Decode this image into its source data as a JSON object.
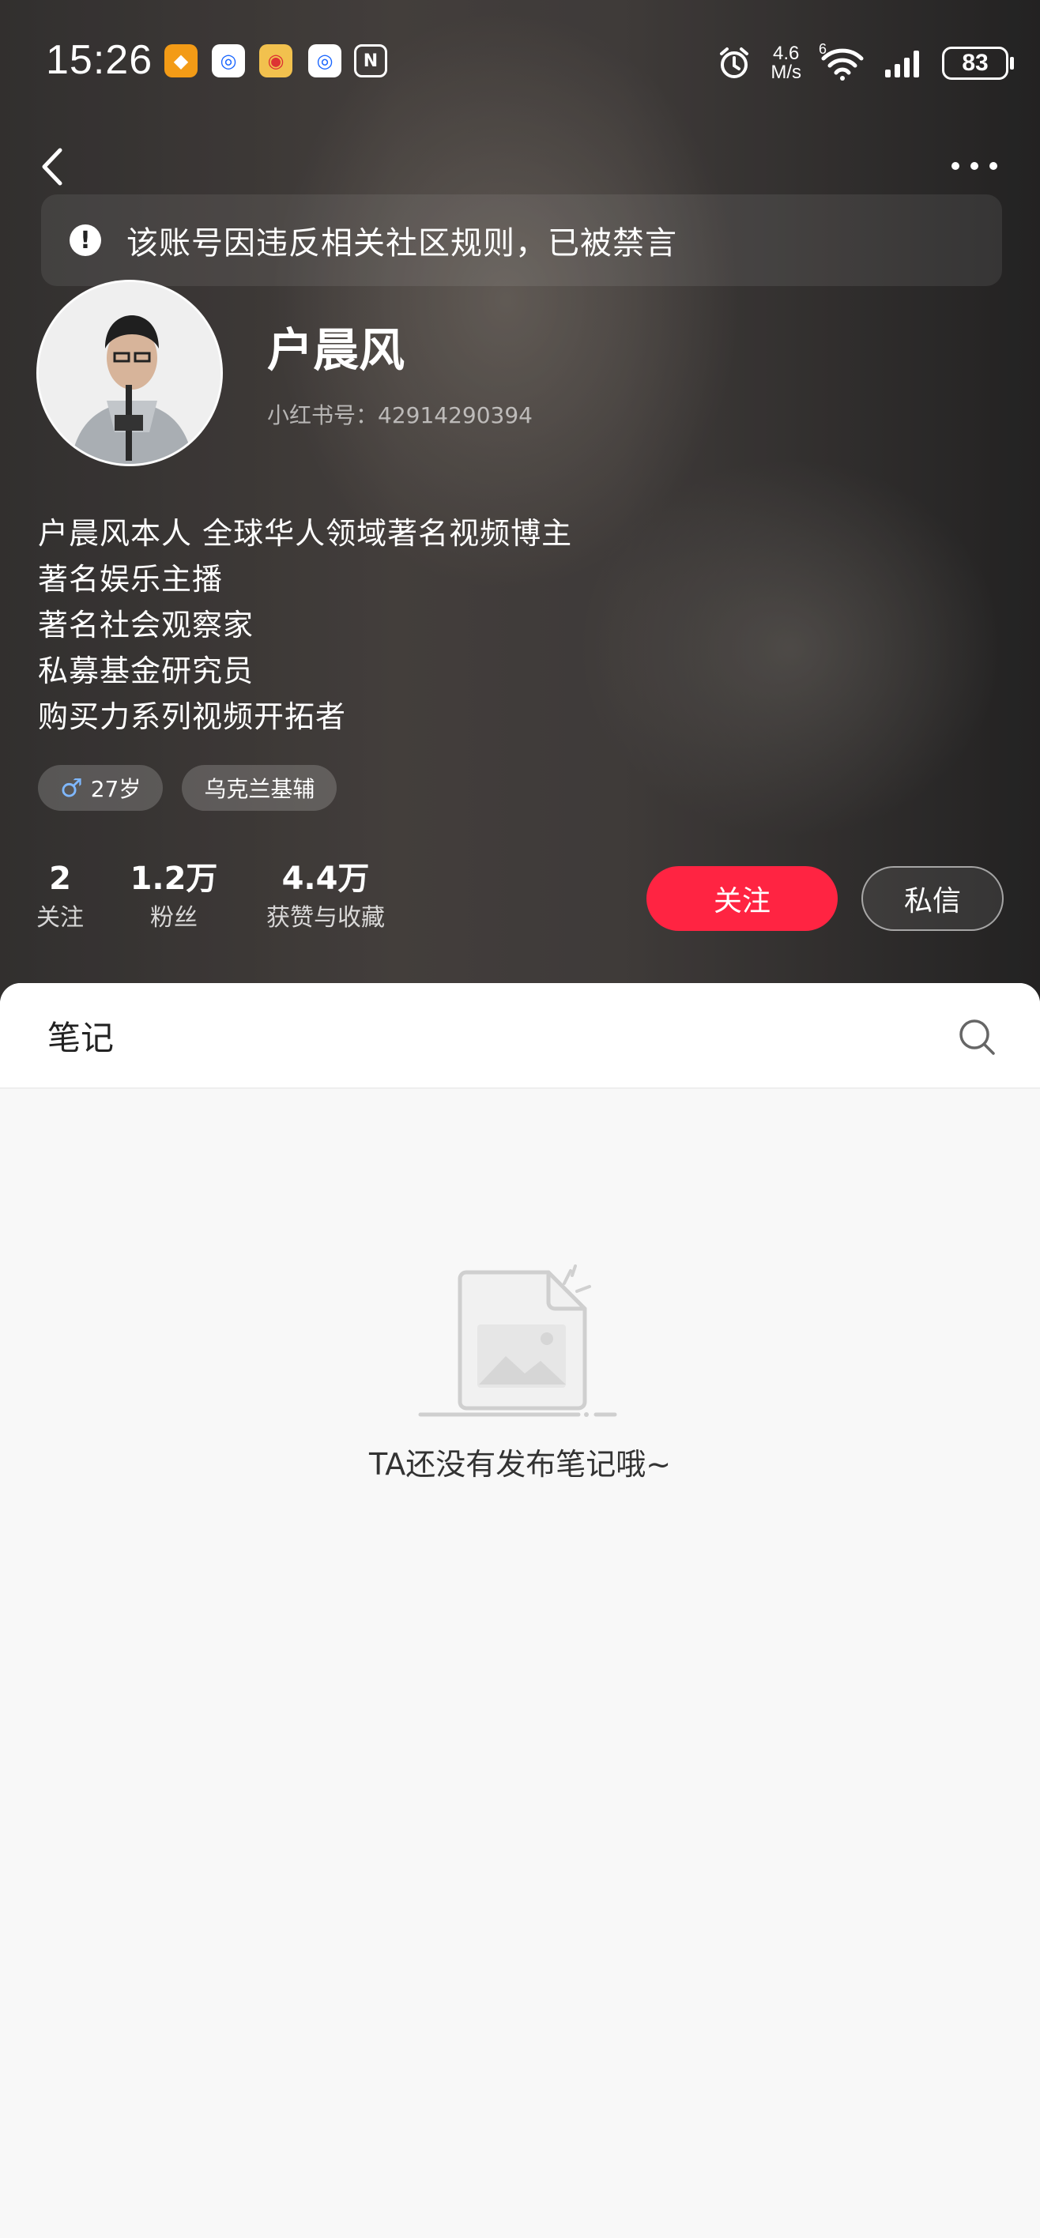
{
  "status_bar": {
    "time": "15:26",
    "apps": [
      {
        "icon": "taobao-icon",
        "glyph": "◆",
        "color": "#f39b16"
      },
      {
        "icon": "app-icon",
        "glyph": "◎",
        "color": "#1a66ff"
      },
      {
        "icon": "weibo-icon",
        "glyph": "◉",
        "color": "#e8a23a"
      },
      {
        "icon": "app-icon",
        "glyph": "◎",
        "color": "#1a66ff"
      },
      {
        "icon": "nfc-icon",
        "glyph": "N",
        "color": "transparent"
      }
    ],
    "speed_value": "4.6",
    "speed_unit": "M/s",
    "network": "6",
    "battery": "83"
  },
  "banner": {
    "text": "该账号因违反相关社区规则，已被禁言"
  },
  "profile": {
    "name": "户晨风",
    "red_id": "小红书号：42914290394",
    "bio": [
      "户晨风本人  全球华人领域著名视频博主",
      "著名娱乐主播",
      "著名社会观察家",
      "私募基金研究员",
      "购买力系列视频开拓者"
    ],
    "tags": {
      "age": "27岁",
      "location": "乌克兰基辅"
    },
    "stats": {
      "following": {
        "value": "2",
        "label": "关注"
      },
      "fans": {
        "value": "1.2万",
        "label": "粉丝"
      },
      "likes": {
        "value": "4.4万",
        "label": "获赞与收藏"
      }
    },
    "follow_label": "关注",
    "message_label": "私信"
  },
  "notes": {
    "tab_label": "笔记",
    "empty_text": "TA还没有发布笔记哦~"
  },
  "colors": {
    "accent": "#ff2442",
    "background": "#f8f8f8"
  }
}
